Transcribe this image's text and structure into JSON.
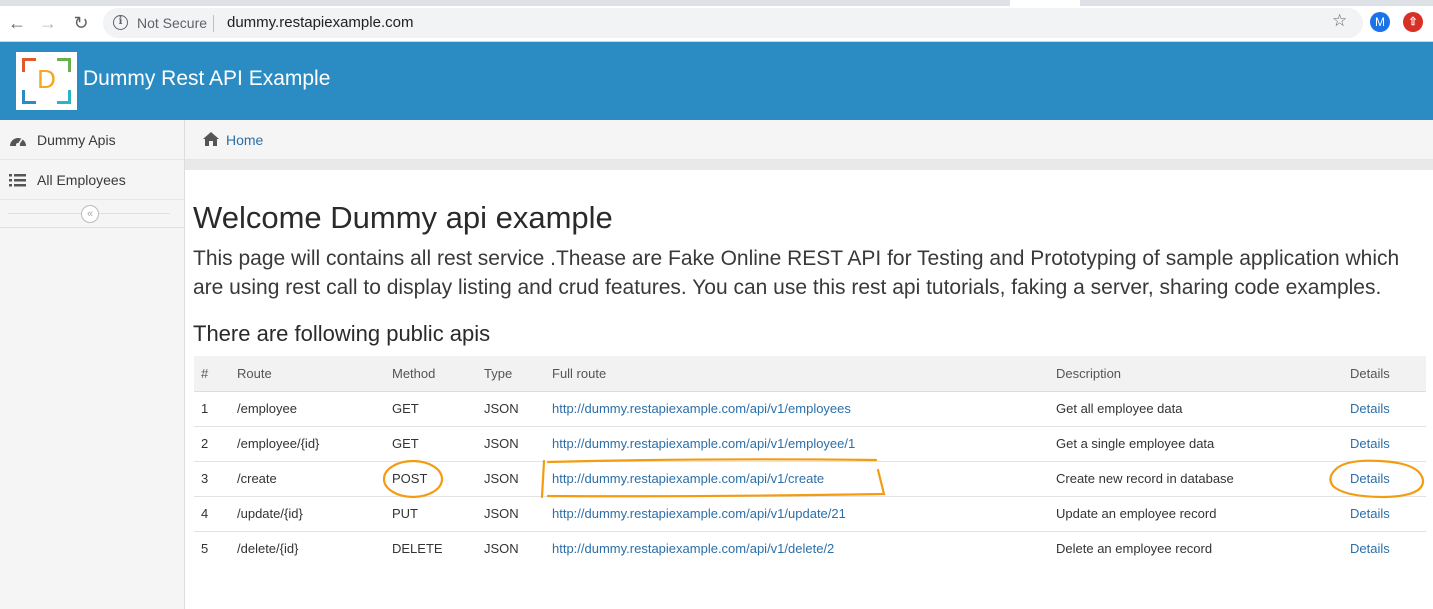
{
  "browser": {
    "security_label": "Not Secure",
    "url": "dummy.restapiexample.com",
    "profile_initial": "M"
  },
  "header": {
    "logo_letter": "D",
    "title": "Dummy Rest API Example",
    "background": "#2b8cc4"
  },
  "sidebar": {
    "items": [
      {
        "label": "Dummy Apis",
        "icon": "dashboard-icon"
      },
      {
        "label": "All Employees",
        "icon": "list-icon"
      }
    ]
  },
  "breadcrumb": {
    "home_label": "Home"
  },
  "main": {
    "title": "Welcome Dummy api example",
    "intro": "This page will contains all rest service .Thease are Fake Online REST API for Testing and Prototyping of sample application which are using rest call to display listing and crud features. You can use this rest api tutorials, faking a server, sharing code examples.",
    "subheading": "There are following public apis"
  },
  "table": {
    "headers": [
      "#",
      "Route",
      "Method",
      "Type",
      "Full route",
      "Description",
      "Details"
    ],
    "rows": [
      {
        "num": "1",
        "route": "/employee",
        "method": "GET",
        "type": "JSON",
        "full_route": "http://dummy.restapiexample.com/api/v1/employees",
        "description": "Get all employee data",
        "details": "Details"
      },
      {
        "num": "2",
        "route": "/employee/{id}",
        "method": "GET",
        "type": "JSON",
        "full_route": "http://dummy.restapiexample.com/api/v1/employee/1",
        "description": "Get a single employee data",
        "details": "Details"
      },
      {
        "num": "3",
        "route": "/create",
        "method": "POST",
        "type": "JSON",
        "full_route": "http://dummy.restapiexample.com/api/v1/create",
        "description": "Create new record in database",
        "details": "Details"
      },
      {
        "num": "4",
        "route": "/update/{id}",
        "method": "PUT",
        "type": "JSON",
        "full_route": "http://dummy.restapiexample.com/api/v1/update/21",
        "description": "Update an employee record",
        "details": "Details"
      },
      {
        "num": "5",
        "route": "/delete/{id}",
        "method": "DELETE",
        "type": "JSON",
        "full_route": "http://dummy.restapiexample.com/api/v1/delete/2",
        "description": "Delete an employee record",
        "details": "Details"
      }
    ]
  },
  "annotation_color": "#f39c12"
}
